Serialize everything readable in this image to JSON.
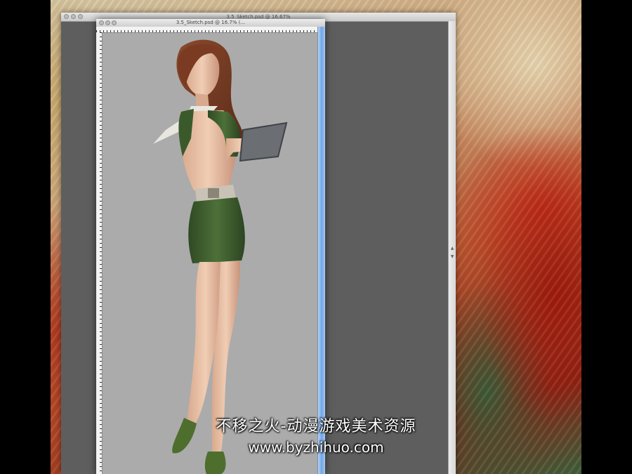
{
  "back_window": {
    "title": "3.5_Sketch.psd @ 16.67%"
  },
  "front_window": {
    "title": "3.5_Sketch.psd @ 16.7% (..."
  },
  "watermark": {
    "line1": "不移之火-动漫游戏美术资源",
    "line2": "www.byzhihuo.com"
  },
  "colors": {
    "canvas_gray": "#ababab",
    "workspace_gray": "#5e5e5e",
    "scrollbar_blue": "#6ea6e8",
    "outfit_green": "#3f5f2f"
  }
}
